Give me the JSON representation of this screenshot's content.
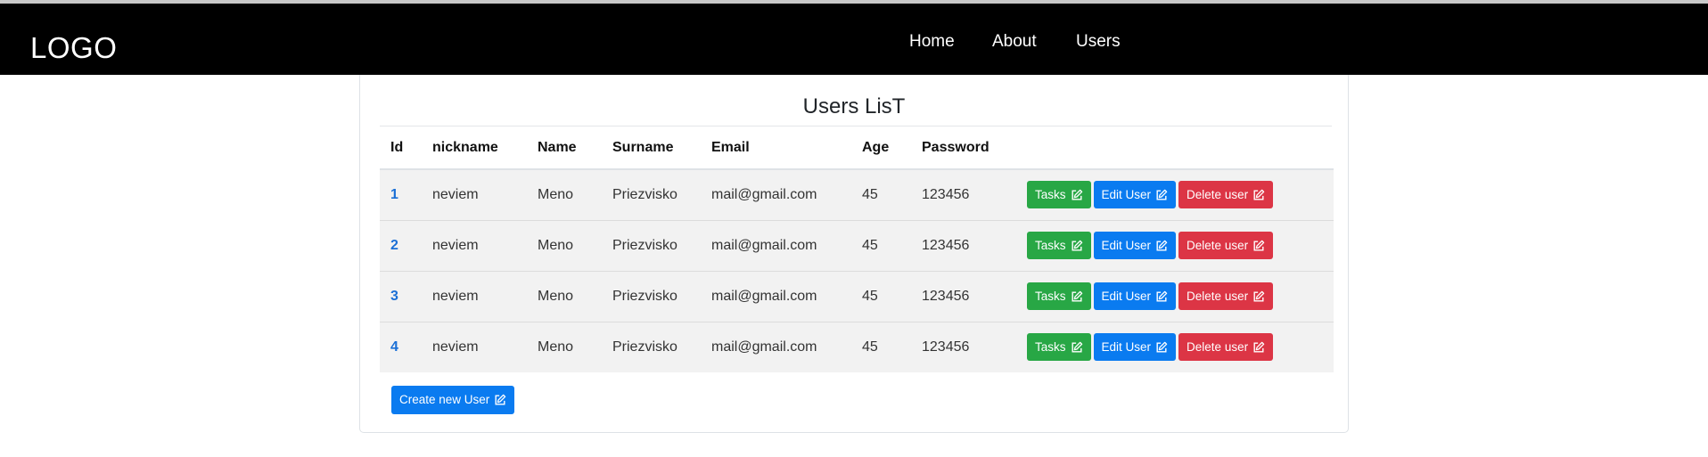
{
  "navbar": {
    "logo": "LOGO",
    "links": [
      "Home",
      "About",
      "Users"
    ]
  },
  "card": {
    "title": "Users LisT",
    "columns": [
      "Id",
      "nickname",
      "Name",
      "Surname",
      "Email",
      "Age",
      "Password",
      ""
    ],
    "rows": [
      {
        "id": "1",
        "nickname": "neviem",
        "name": "Meno",
        "surname": "Priezvisko",
        "email": "mail@gmail.com",
        "age": "45",
        "password": "123456"
      },
      {
        "id": "2",
        "nickname": "neviem",
        "name": "Meno",
        "surname": "Priezvisko",
        "email": "mail@gmail.com",
        "age": "45",
        "password": "123456"
      },
      {
        "id": "3",
        "nickname": "neviem",
        "name": "Meno",
        "surname": "Priezvisko",
        "email": "mail@gmail.com",
        "age": "45",
        "password": "123456"
      },
      {
        "id": "4",
        "nickname": "neviem",
        "name": "Meno",
        "surname": "Priezvisko",
        "email": "mail@gmail.com",
        "age": "45",
        "password": "123456"
      }
    ],
    "actions": {
      "tasks": "Tasks",
      "edit": "Edit User",
      "delete": "Delete user"
    },
    "create_label": "Create new User"
  },
  "icons": {
    "action": "edit-icon"
  },
  "colors": {
    "navbar": "#000000",
    "id_link": "#1a6fd6",
    "tasks_button": "#28a745",
    "edit_button": "#0a7bf0",
    "delete_button": "#dc3545",
    "create_button": "#0a7bf0",
    "row_background": "#f2f2f2"
  }
}
